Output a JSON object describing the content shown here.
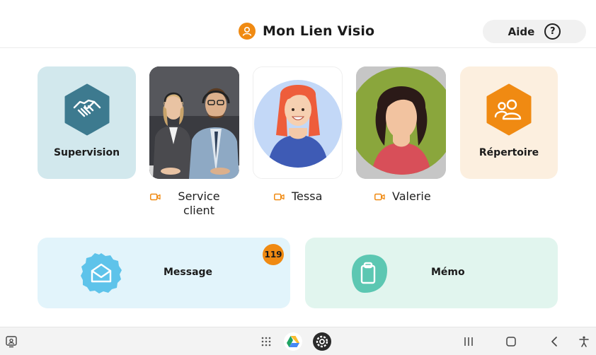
{
  "header": {
    "title": "Mon Lien Visio",
    "logo_icon": "person-circle-icon",
    "help_label": "Aide",
    "help_icon_glyph": "?"
  },
  "tiles": {
    "supervision": {
      "label": "Supervision",
      "icon": "handshake-icon",
      "color": "#d2e8ed",
      "icon_color": "#3d7a8f"
    },
    "repertoire": {
      "label": "Répertoire",
      "icon": "people-icon",
      "color": "#fcefdf",
      "icon_color": "#f08a12"
    }
  },
  "contacts": [
    {
      "name": "Service client",
      "line1": "Service",
      "line2": "client",
      "icon": "video-camera-icon"
    },
    {
      "name": "Tessa",
      "icon": "video-camera-icon"
    },
    {
      "name": "Valerie",
      "icon": "video-camera-icon"
    }
  ],
  "cards": {
    "message": {
      "label": "Message",
      "badge": "119",
      "icon": "envelope-open-icon",
      "color": "#e2f4fb"
    },
    "memo": {
      "label": "Mémo",
      "icon": "clipboard-icon",
      "color": "#e1f5ee"
    }
  },
  "navbar": {
    "items": [
      "screen-share-icon",
      "app-drawer-icon",
      "google-drive-icon",
      "settings-gear-icon",
      "recent-apps-icon",
      "home-icon",
      "back-icon",
      "accessibility-icon"
    ]
  },
  "colors": {
    "accent": "#f08a12",
    "text": "#1b1b1b"
  }
}
